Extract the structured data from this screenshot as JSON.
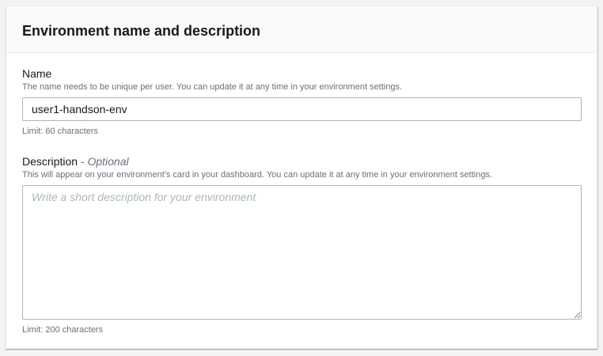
{
  "section": {
    "title": "Environment name and description"
  },
  "name_field": {
    "label": "Name",
    "description": "The name needs to be unique per user. You can update it at any time in your environment settings.",
    "value": "user1-handson-env",
    "constraint": "Limit: 60 characters"
  },
  "description_field": {
    "label": "Description",
    "optional": "- Optional",
    "description": "This will appear on your environment's card in your dashboard. You can update it at any time in your environment settings.",
    "value": "",
    "placeholder": "Write a short description for your environment",
    "constraint": "Limit: 200 characters"
  }
}
